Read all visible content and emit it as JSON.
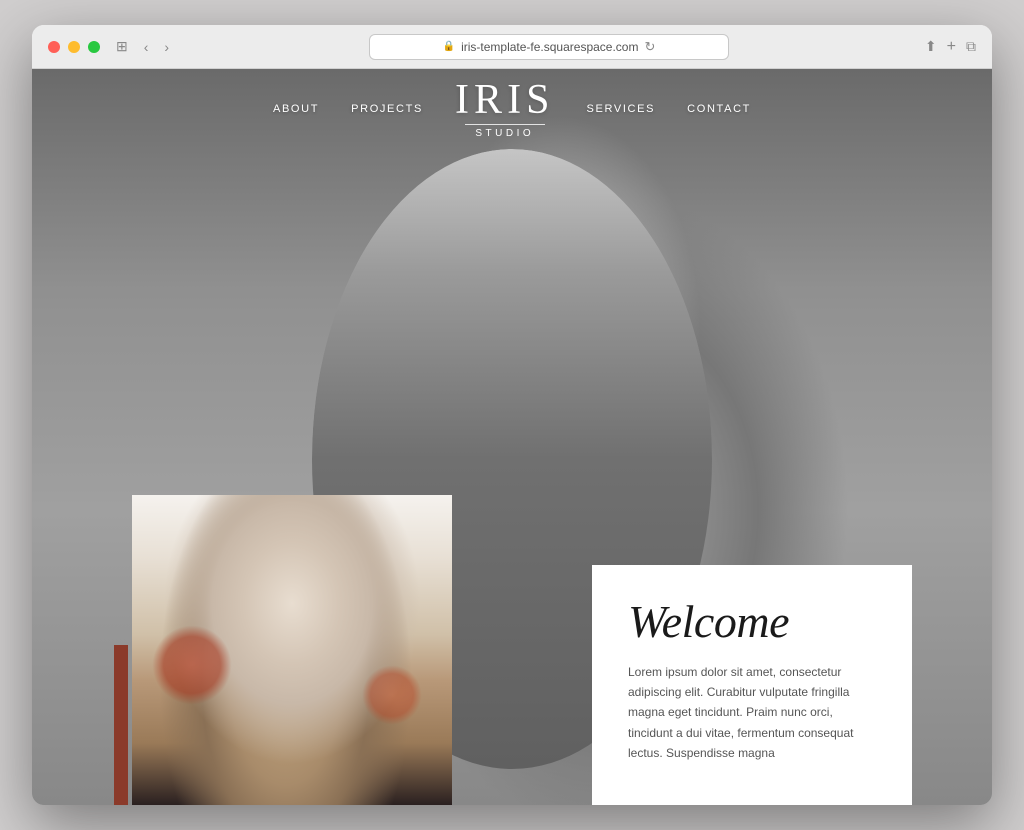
{
  "window": {
    "title": "iris-template-fe.squarespace.com",
    "url": "iris-template-fe.squarespace.com"
  },
  "nav": {
    "items_left": [
      {
        "label": "ABOUT",
        "id": "about"
      },
      {
        "label": "PROJECTS",
        "id": "projects"
      }
    ],
    "logo": {
      "name": "IRIS",
      "subtitle": "STUDIO"
    },
    "items_right": [
      {
        "label": "SERVICES",
        "id": "services"
      },
      {
        "label": "CONTACT",
        "id": "contact"
      }
    ]
  },
  "hero": {
    "welcome_title": "Welcome",
    "welcome_body": "Lorem ipsum dolor sit amet, consectetur adipiscing elit. Curabitur vulputate fringilla magna eget tincidunt. Praim nunc orci, tincidunt a dui vitae, fermentum consequat lectus. Suspendisse magna"
  },
  "icons": {
    "lock": "🔒",
    "refresh": "↻",
    "share": "↑",
    "new_tab": "+",
    "windows": "⧉"
  },
  "colors": {
    "red_accent": "#8b3a2a",
    "nav_text": "#ffffff",
    "body_text": "#555555",
    "heading_text": "#1a1a1a"
  }
}
